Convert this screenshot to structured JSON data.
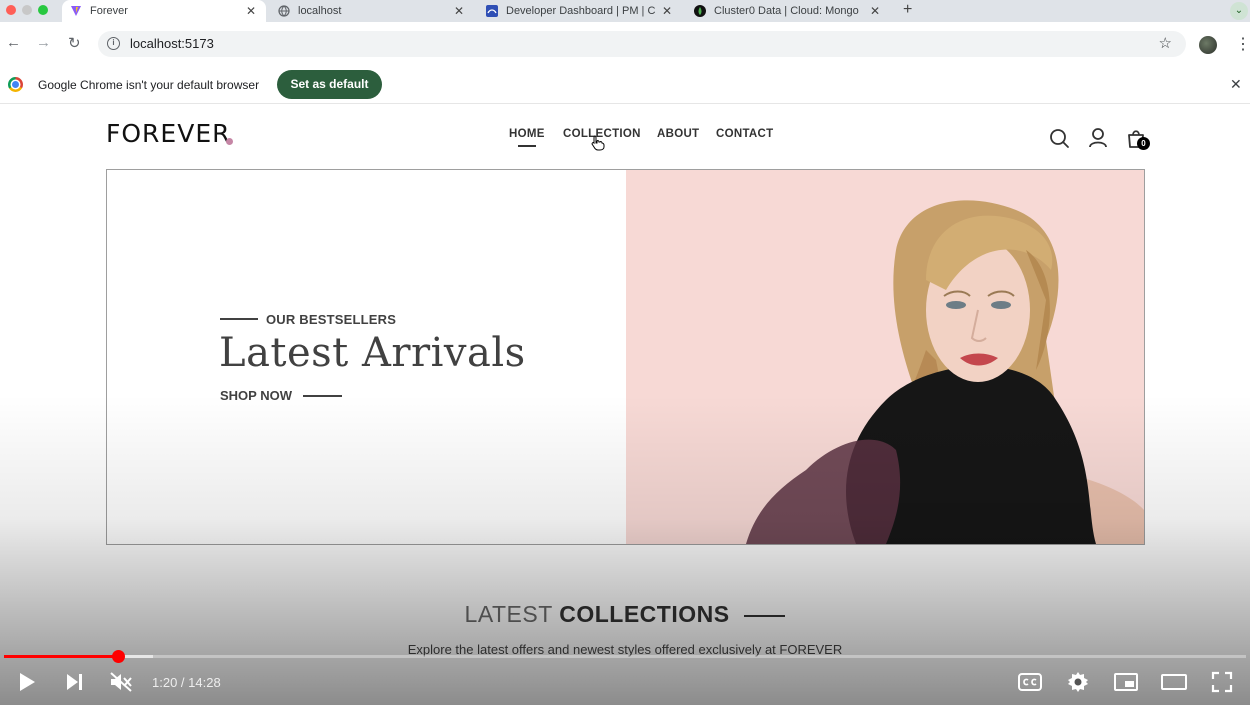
{
  "browser": {
    "tabs": [
      {
        "title": "Forever",
        "active": true
      },
      {
        "title": "localhost",
        "active": false
      },
      {
        "title": "Developer Dashboard | PM | C",
        "active": false
      },
      {
        "title": "Cluster0 Data | Cloud: Mongo",
        "active": false
      }
    ],
    "url": "localhost:5173",
    "infobar_text": "Google Chrome isn't your default browser",
    "infobar_button": "Set as default"
  },
  "site": {
    "logo": "FOREVER",
    "nav": [
      "HOME",
      "COLLECTION",
      "ABOUT",
      "CONTACT"
    ],
    "cart_count": "0",
    "hero": {
      "kicker": "OUR BESTSELLERS",
      "headline": "Latest Arrivals",
      "cta": "SHOP NOW"
    },
    "section": {
      "title_light": "LATEST",
      "title_bold": "COLLECTIONS",
      "subtitle": "Explore the latest offers and newest styles offered exclusively at FOREVER"
    }
  },
  "player": {
    "time": "1:20 / 14:28",
    "progress": 0.092,
    "buffered": 0.12
  },
  "colors": {
    "accent": "#c586a5",
    "hero_bg": "#f7d9d5",
    "progress": "#ff0000",
    "infobar_button": "#2c5e3d"
  }
}
